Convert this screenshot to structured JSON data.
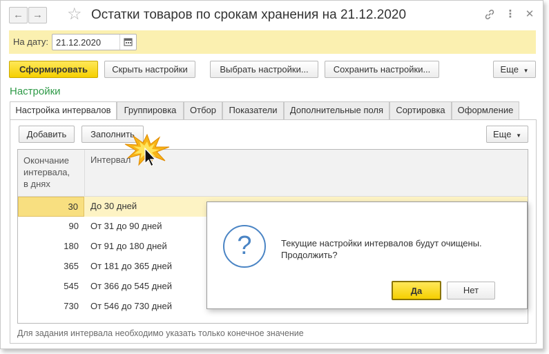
{
  "window": {
    "title": "Остатки товаров по срокам хранения на 21.12.2020",
    "back_glyph": "←",
    "forward_glyph": "→",
    "star_glyph": "☆",
    "link_glyph": "🔗",
    "more_glyph": "⋮",
    "close_glyph": "✕"
  },
  "period": {
    "label": "На дату:",
    "value": "21.12.2020"
  },
  "toolbar": {
    "generate": "Сформировать",
    "hide_settings": "Скрыть настройки",
    "choose_settings": "Выбрать настройки...",
    "save_settings": "Сохранить настройки...",
    "more": "Еще"
  },
  "settings": {
    "title": "Настройки",
    "tabs": [
      {
        "label": "Настройка интервалов"
      },
      {
        "label": "Группировка"
      },
      {
        "label": "Отбор"
      },
      {
        "label": "Показатели"
      },
      {
        "label": "Дополнительные поля"
      },
      {
        "label": "Сортировка"
      },
      {
        "label": "Оформление"
      }
    ],
    "add": "Добавить",
    "fill": "Заполнить",
    "more": "Еще"
  },
  "table": {
    "columns": {
      "days_line1": "Окончание",
      "days_line2": "интервала,",
      "days_line3": "в днях",
      "interval": "Интервал"
    },
    "rows": [
      {
        "days": "30",
        "name": "До 30 дней"
      },
      {
        "days": "90",
        "name": "От 31 до 90 дней"
      },
      {
        "days": "180",
        "name": "От 91 до 180 дней"
      },
      {
        "days": "365",
        "name": "От 181 до 365 дней"
      },
      {
        "days": "545",
        "name": "От 366 до 545 дней"
      },
      {
        "days": "730",
        "name": "От 546 до 730 дней"
      }
    ]
  },
  "hint": "Для задания интервала необходимо указать только конечное значение",
  "dialog": {
    "icon": "?",
    "line1": "Текущие настройки интервалов будут очищены.",
    "line2": "Продолжить?",
    "yes": "Да",
    "no": "Нет"
  },
  "colors": {
    "accent_yellow": "#f5cf00",
    "bar_yellow": "#fbf0b0",
    "selected_row": "#fdf3c4",
    "selected_cell": "#f8df80",
    "section_green": "#2f9a48",
    "dialog_icon_blue": "#4a84c4"
  }
}
